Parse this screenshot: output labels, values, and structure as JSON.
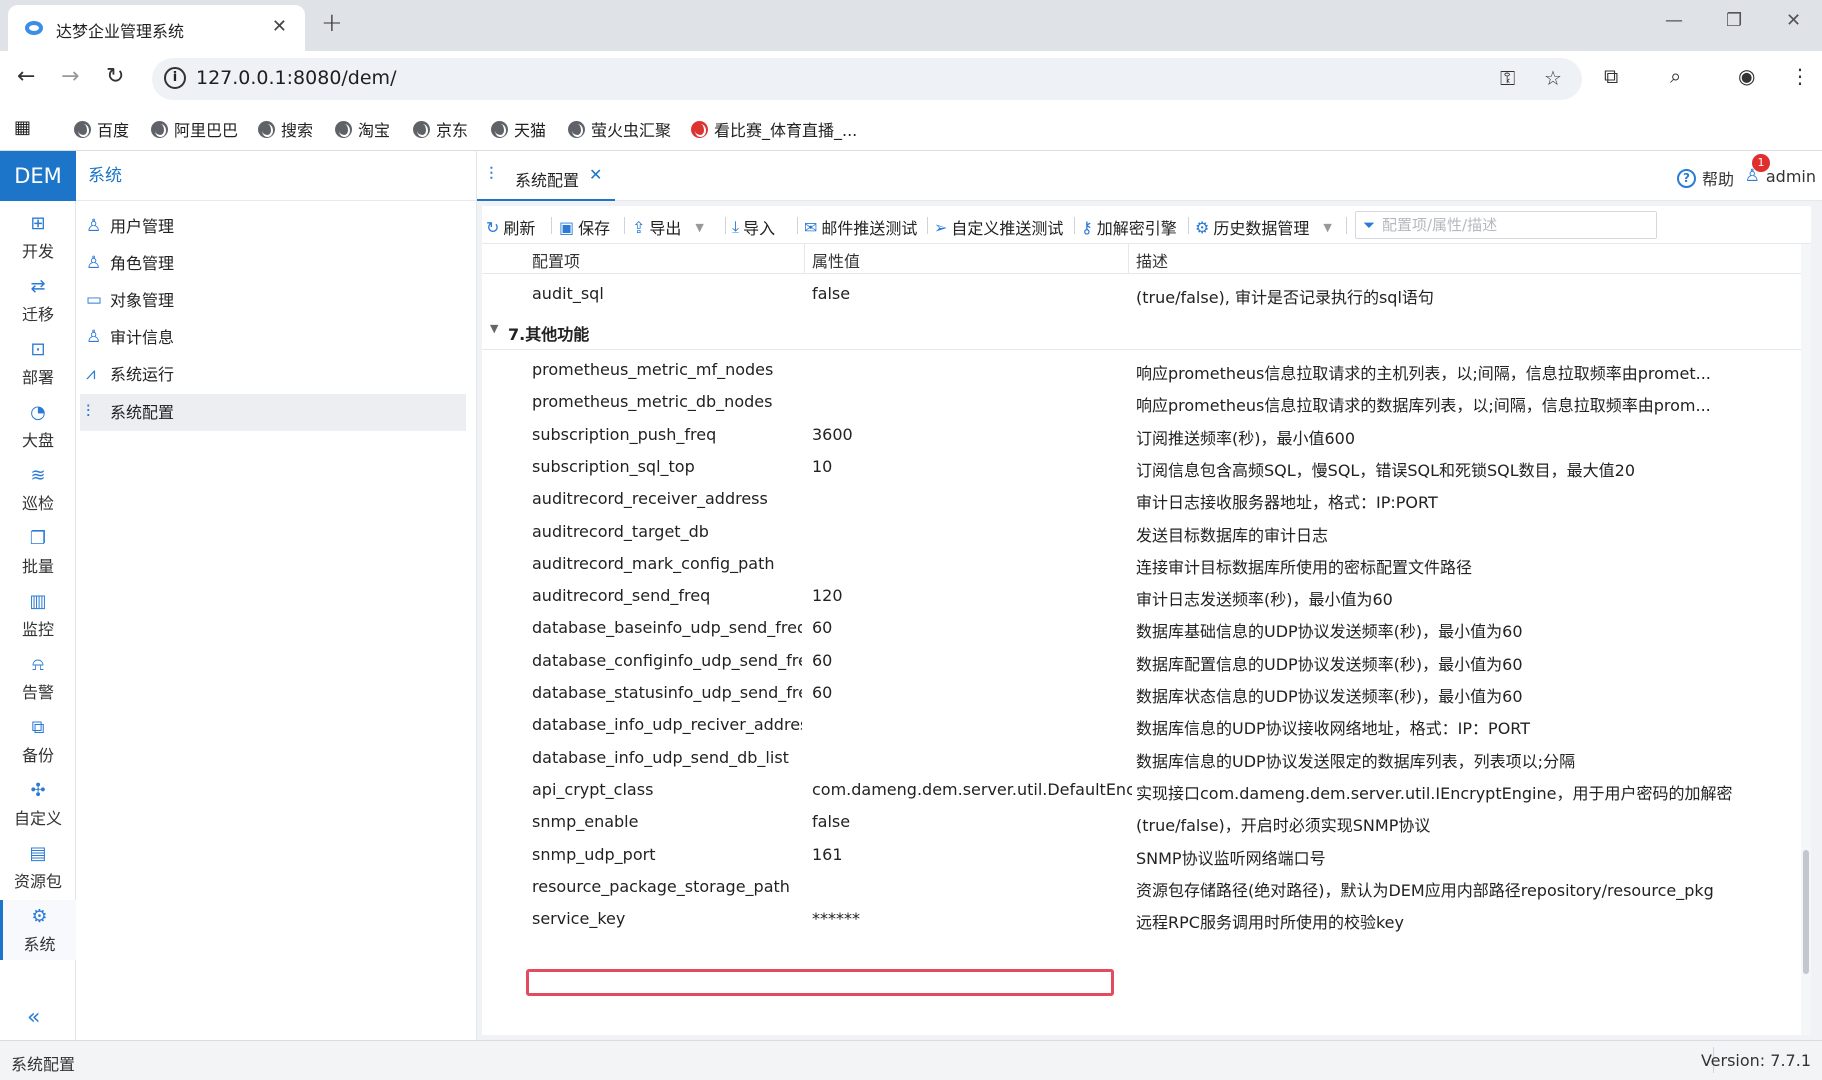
{
  "browser": {
    "tab_title": "达梦企业管理系统",
    "url": "127.0.0.1:8080/dem/",
    "bookmarks": [
      "百度",
      "阿里巴巴",
      "搜索",
      "淘宝",
      "京东",
      "天猫",
      "萤火虫汇聚",
      "看比赛_体育直播_..."
    ]
  },
  "app": {
    "logo": "DEM",
    "nav": [
      {
        "label": "开发",
        "icon": "grid-icon"
      },
      {
        "label": "迁移",
        "icon": "migrate-icon"
      },
      {
        "label": "部署",
        "icon": "deploy-icon"
      },
      {
        "label": "大盘",
        "icon": "dashboard-icon"
      },
      {
        "label": "巡检",
        "icon": "inspect-icon"
      },
      {
        "label": "批量",
        "icon": "batch-icon"
      },
      {
        "label": "监控",
        "icon": "monitor-icon"
      },
      {
        "label": "告警",
        "icon": "alarm-icon"
      },
      {
        "label": "备份",
        "icon": "backup-icon"
      },
      {
        "label": "自定义",
        "icon": "puzzle-icon"
      },
      {
        "label": "资源包",
        "icon": "package-icon"
      },
      {
        "label": "系统",
        "icon": "gear-icon"
      }
    ],
    "submenu_title": "系统",
    "submenu": [
      "用户管理",
      "角色管理",
      "对象管理",
      "审计信息",
      "系统运行",
      "系统配置"
    ],
    "main_tab": "系统配置",
    "help": "帮助",
    "user": "admin",
    "notification_count": "1"
  },
  "toolbar": {
    "refresh": "刷新",
    "save": "保存",
    "export": "导出",
    "import": "导入",
    "mail_test": "邮件推送测试",
    "custom_test": "自定义推送测试",
    "crypt_engine": "加解密引擎",
    "history": "历史数据管理",
    "filter_placeholder": "配置项/属性/描述"
  },
  "grid": {
    "headers": [
      "配置项",
      "属性值",
      "描述"
    ],
    "top_row": {
      "key": "audit_sql",
      "value": "false",
      "desc": "(true/false), 审计是否记录执行的sql语句"
    },
    "group": "7.其他功能",
    "rows": [
      {
        "key": "prometheus_metric_mf_nodes",
        "value": "",
        "desc": "响应prometheus信息拉取请求的主机列表，以;间隔，信息拉取频率由promet..."
      },
      {
        "key": "prometheus_metric_db_nodes",
        "value": "",
        "desc": "响应prometheus信息拉取请求的数据库列表，以;间隔，信息拉取频率由prom..."
      },
      {
        "key": "subscription_push_freq",
        "value": "3600",
        "desc": "订阅推送频率(秒)，最小值600"
      },
      {
        "key": "subscription_sql_top",
        "value": "10",
        "desc": "订阅信息包含高频SQL，慢SQL，错误SQL和死锁SQL数目，最大值20"
      },
      {
        "key": "auditrecord_receiver_address",
        "value": "",
        "desc": "审计日志接收服务器地址，格式：IP:PORT"
      },
      {
        "key": "auditrecord_target_db",
        "value": "",
        "desc": "发送目标数据库的审计日志"
      },
      {
        "key": "auditrecord_mark_config_path",
        "value": "",
        "desc": "连接审计目标数据库所使用的密标配置文件路径"
      },
      {
        "key": "auditrecord_send_freq",
        "value": "120",
        "desc": "审计日志发送频率(秒)，最小值为60"
      },
      {
        "key": "database_baseinfo_udp_send_freq",
        "value": "60",
        "desc": "数据库基础信息的UDP协议发送频率(秒)，最小值为60"
      },
      {
        "key": "database_configinfo_udp_send_freq",
        "value": "60",
        "desc": "数据库配置信息的UDP协议发送频率(秒)，最小值为60"
      },
      {
        "key": "database_statusinfo_udp_send_freq",
        "value": "60",
        "desc": "数据库状态信息的UDP协议发送频率(秒)，最小值为60"
      },
      {
        "key": "database_info_udp_reciver_address",
        "value": "",
        "desc": "数据库信息的UDP协议接收网络地址，格式：IP：PORT"
      },
      {
        "key": "database_info_udp_send_db_list",
        "value": "",
        "desc": "数据库信息的UDP协议发送限定的数据库列表，列表项以;分隔"
      },
      {
        "key": "api_crypt_class",
        "value": "com.dameng.dem.server.util.DefaultEncryptEngine",
        "desc": "实现接口com.dameng.dem.server.util.IEncryptEngine，用于用户密码的加解密"
      },
      {
        "key": "snmp_enable",
        "value": "false",
        "desc": "(true/false)，开启时必须实现SNMP协议"
      },
      {
        "key": "snmp_udp_port",
        "value": "161",
        "desc": "SNMP协议监听网络端口号"
      },
      {
        "key": "resource_package_storage_path",
        "value": "",
        "desc": "资源包存储路径(绝对路径)，默认为DEM应用内部路径repository/resource_pkg"
      },
      {
        "key": "service_key",
        "value": "******",
        "desc": "远程RPC服务调用时所使用的校验key"
      }
    ]
  },
  "status": {
    "left": "系统配置",
    "version": "Version: 7.7.1"
  },
  "colors": {
    "accent": "#1c75c8",
    "highlight_border": "#e34b5f"
  }
}
